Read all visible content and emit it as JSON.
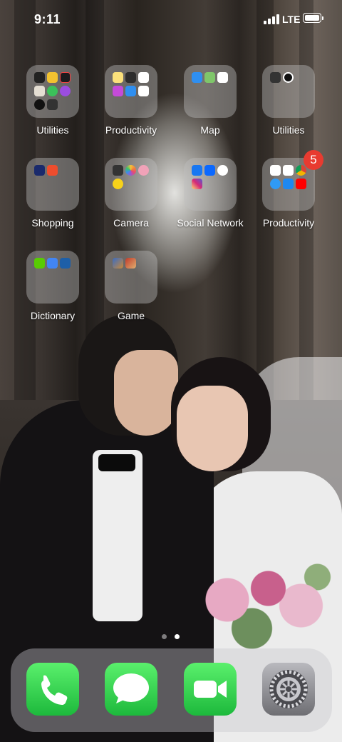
{
  "status_bar": {
    "time": "9:11",
    "network": "LTE",
    "battery_level": 1.0
  },
  "folders": [
    {
      "label": "Utilities",
      "icons": [
        "camera-icon",
        "flashlight-icon",
        "voice-memos-icon",
        "contacts-icon",
        "find-my-icon",
        "podcasts-icon",
        "watch-icon",
        "calculator-icon"
      ],
      "badge": ""
    },
    {
      "label": "Productivity",
      "icons": [
        "notes-icon",
        "wallet-icon",
        "reminders-icon",
        "itunes-store-icon",
        "files-icon",
        "health-icon"
      ],
      "badge": ""
    },
    {
      "label": "Map",
      "icons": [
        "files-icon",
        "maps-icon",
        "gmail-icon"
      ],
      "badge": ""
    },
    {
      "label": "Utilities",
      "icons": [
        "calculator-icon",
        "clock-icon"
      ],
      "badge": ""
    },
    {
      "label": "Shopping",
      "icons": [
        "lazada-icon",
        "shopee-icon"
      ],
      "badge": ""
    },
    {
      "label": "Camera",
      "icons": [
        "camera-icon",
        "photos-icon",
        "snapseed-icon",
        "yellow-camera-icon"
      ],
      "badge": ""
    },
    {
      "label": "Social Network",
      "icons": [
        "facebook-icon",
        "zalo-icon",
        "messenger-icon",
        "instagram-icon"
      ],
      "badge": ""
    },
    {
      "label": "Productivity",
      "icons": [
        "google-drive-icon",
        "google-photos-icon",
        "chrome-icon",
        "safari-icon",
        "app-store-icon",
        "youtube-icon"
      ],
      "badge": "5"
    },
    {
      "label": "Dictionary",
      "icons": [
        "duolingo-icon",
        "google-translate-icon",
        "dictionary-icon"
      ],
      "badge": ""
    },
    {
      "label": "Game",
      "icons": [
        "game-one-icon",
        "game-two-icon"
      ],
      "badge": ""
    }
  ],
  "page_dots": {
    "count": 2,
    "active": 1
  },
  "dock": [
    {
      "name": "phone",
      "icon": "phone-icon",
      "color": "#34c759"
    },
    {
      "name": "messages",
      "icon": "messages-icon",
      "color": "#34c759"
    },
    {
      "name": "facetime",
      "icon": "facetime-icon",
      "color": "#34c759"
    },
    {
      "name": "settings",
      "icon": "settings-gear-icon",
      "color": "#8e8e93"
    }
  ]
}
